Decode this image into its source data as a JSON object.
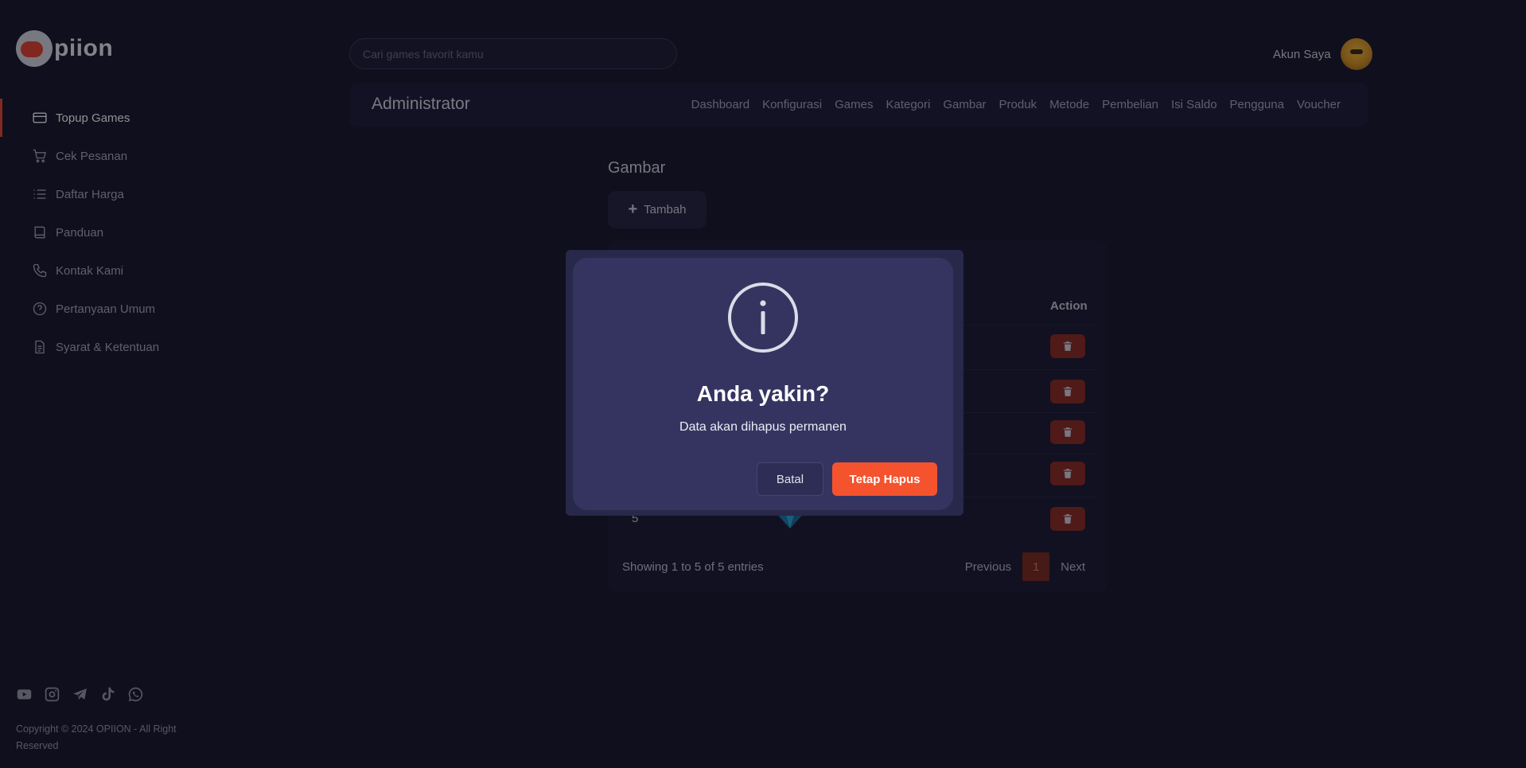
{
  "brand": {
    "name": "piion"
  },
  "sidebar": {
    "items": [
      {
        "label": "Topup Games",
        "icon": "credit-card-icon",
        "active": true
      },
      {
        "label": "Cek Pesanan",
        "icon": "cart-icon"
      },
      {
        "label": "Daftar Harga",
        "icon": "list-icon"
      },
      {
        "label": "Panduan",
        "icon": "book-icon"
      },
      {
        "label": "Kontak Kami",
        "icon": "phone-icon"
      },
      {
        "label": "Pertanyaan Umum",
        "icon": "question-circle-icon"
      },
      {
        "label": "Syarat & Ketentuan",
        "icon": "document-icon"
      }
    ],
    "social": [
      "youtube-icon",
      "instagram-icon",
      "telegram-icon",
      "tiktok-icon",
      "whatsapp-icon"
    ],
    "copyright": "Copyright © 2024 OPIION - All Right Reserved"
  },
  "header": {
    "search_placeholder": "Cari games favorit kamu",
    "account_label": "Akun Saya"
  },
  "admin_bar": {
    "title": "Administrator",
    "nav": [
      "Dashboard",
      "Konfigurasi",
      "Games",
      "Kategori",
      "Gambar",
      "Produk",
      "Metode",
      "Pembelian",
      "Isi Saldo",
      "Pengguna",
      "Voucher"
    ]
  },
  "content": {
    "page_title": "Gambar",
    "add_label": "Tambah",
    "table": {
      "action_header": "Action",
      "last_row_number": "5"
    },
    "entries_text": "Showing 1 to 5 of 5 entries",
    "pagination": {
      "previous": "Previous",
      "current": "1",
      "next": "Next"
    }
  },
  "modal": {
    "icon": "info-icon",
    "title": "Anda yakin?",
    "text": "Data akan dihapus permanen",
    "cancel_label": "Batal",
    "confirm_label": "Tetap Hapus"
  },
  "colors": {
    "background": "#161629",
    "modal": "#353461",
    "confirm": "#f4532e",
    "delete": "#8a2a20",
    "active_indicator": "#e8452f"
  }
}
